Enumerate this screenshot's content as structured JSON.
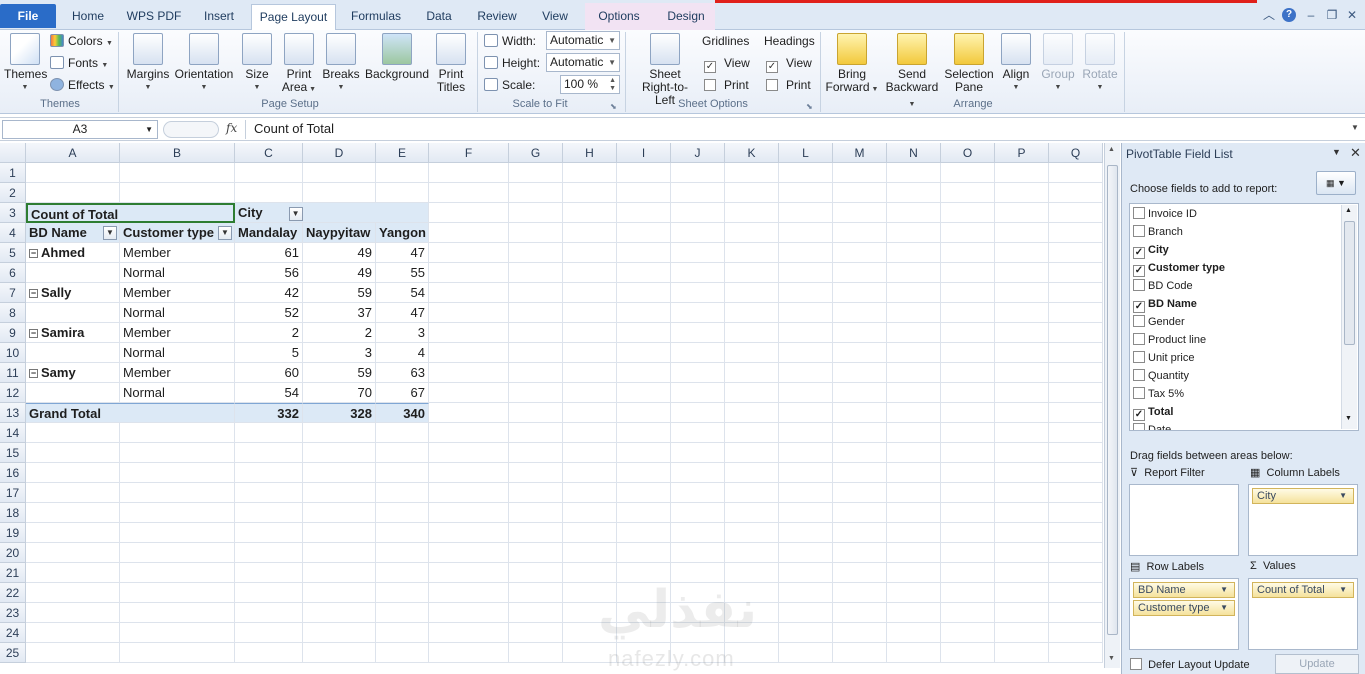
{
  "colors": {
    "file_tab": "#2a6cc8",
    "red_line": "#e0201a",
    "pivot_header_fill": "#dce9f6"
  },
  "tabs": [
    {
      "label": "File"
    },
    {
      "label": "Home"
    },
    {
      "label": "WPS PDF"
    },
    {
      "label": "Insert"
    },
    {
      "label": "Page Layout"
    },
    {
      "label": "Formulas"
    },
    {
      "label": "Data"
    },
    {
      "label": "Review"
    },
    {
      "label": "View"
    },
    {
      "label": "Options"
    },
    {
      "label": "Design"
    }
  ],
  "ribbon": {
    "themes": {
      "label": "Themes",
      "colors": "Colors",
      "fonts": "Fonts",
      "effects": "Effects",
      "group": "Themes"
    },
    "page_setup": {
      "margins": "Margins",
      "orientation": "Orientation",
      "size": "Size",
      "print_area_1": "Print",
      "print_area_2": "Area",
      "breaks": "Breaks",
      "background": "Background",
      "print_titles_1": "Print",
      "print_titles_2": "Titles",
      "group": "Page Setup"
    },
    "scale": {
      "width_label": "Width:",
      "width_value": "Automatic",
      "height_label": "Height:",
      "height_value": "Automatic",
      "scale_label": "Scale:",
      "scale_value": "100 %",
      "group": "Scale to Fit"
    },
    "sheet_options": {
      "rtl_1": "Sheet",
      "rtl_2": "Right-to-Left",
      "gridlines": "Gridlines",
      "headings": "Headings",
      "view": "View",
      "print": "Print",
      "group": "Sheet Options"
    },
    "arrange": {
      "bring_1": "Bring",
      "bring_2": "Forward",
      "send_1": "Send",
      "send_2": "Backward",
      "sel_1": "Selection",
      "sel_2": "Pane",
      "align": "Align",
      "group_btn": "Group",
      "rotate": "Rotate",
      "group": "Arrange"
    }
  },
  "formula_bar": {
    "name_box": "A3",
    "fx": "fx",
    "content": "Count of Total"
  },
  "columns": [
    "A",
    "B",
    "C",
    "D",
    "E",
    "F",
    "G",
    "H",
    "I",
    "J",
    "K",
    "L",
    "M",
    "N",
    "O",
    "P",
    "Q"
  ],
  "rows": [
    "1",
    "2",
    "3",
    "4",
    "5",
    "6",
    "7",
    "8",
    "9",
    "10",
    "11",
    "12",
    "13",
    "14",
    "15",
    "16",
    "17",
    "18",
    "19",
    "20",
    "21",
    "22",
    "23",
    "24",
    "25"
  ],
  "pivot": {
    "count_label": "Count of Total",
    "city_label": "City",
    "bd_name_label": "BD Name",
    "customer_type_label": "Customer type",
    "cities": [
      "Mandalay",
      "Naypyitaw",
      "Yangon"
    ],
    "data": [
      {
        "name": "Ahmed",
        "type": "Member",
        "values": [
          "61",
          "49",
          "47"
        ]
      },
      {
        "name": "",
        "type": "Normal",
        "values": [
          "56",
          "49",
          "55"
        ]
      },
      {
        "name": "Sally",
        "type": "Member",
        "values": [
          "42",
          "59",
          "54"
        ]
      },
      {
        "name": "",
        "type": "Normal",
        "values": [
          "52",
          "37",
          "47"
        ]
      },
      {
        "name": "Samira",
        "type": "Member",
        "values": [
          "2",
          "2",
          "3"
        ]
      },
      {
        "name": "",
        "type": "Normal",
        "values": [
          "5",
          "3",
          "4"
        ]
      },
      {
        "name": "Samy",
        "type": "Member",
        "values": [
          "60",
          "59",
          "63"
        ]
      },
      {
        "name": "",
        "type": "Normal",
        "values": [
          "54",
          "70",
          "67"
        ]
      }
    ],
    "grand_total_label": "Grand Total",
    "grand_totals": [
      "332",
      "328",
      "340"
    ]
  },
  "field_list": {
    "title": "PivotTable Field List",
    "choose": "Choose fields to add to report:",
    "fields": [
      {
        "name": "Invoice ID",
        "checked": false
      },
      {
        "name": "Branch",
        "checked": false
      },
      {
        "name": "City",
        "checked": true
      },
      {
        "name": "Customer type",
        "checked": true
      },
      {
        "name": "BD Code",
        "checked": false
      },
      {
        "name": "BD Name",
        "checked": true
      },
      {
        "name": "Gender",
        "checked": false
      },
      {
        "name": "Product line",
        "checked": false
      },
      {
        "name": "Unit price",
        "checked": false
      },
      {
        "name": "Quantity",
        "checked": false
      },
      {
        "name": "Tax 5%",
        "checked": false
      },
      {
        "name": "Total",
        "checked": true
      },
      {
        "name": "Date",
        "checked": false
      }
    ],
    "drag": "Drag fields between areas below:",
    "report_filter": "Report Filter",
    "column_labels": "Column Labels",
    "row_labels": "Row Labels",
    "values": "Values",
    "col_items": [
      "City"
    ],
    "row_items": [
      "BD Name",
      "Customer type"
    ],
    "value_items": [
      "Count of Total"
    ],
    "defer": "Defer Layout Update",
    "update": "Update"
  },
  "watermark": {
    "arabic": "نفذلي",
    "latin": "nafezly.com"
  }
}
